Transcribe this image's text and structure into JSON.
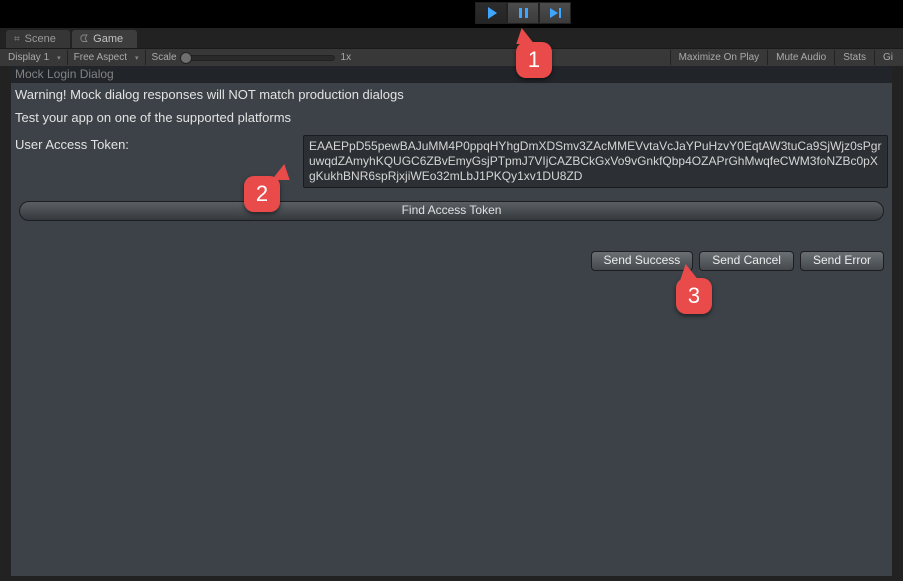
{
  "transport": {
    "play_icon": "play-icon",
    "pause_icon": "pause-icon",
    "step_icon": "step-icon"
  },
  "tabs": {
    "scene": "Scene",
    "game": "Game"
  },
  "options": {
    "display": "Display 1",
    "aspect": "Free Aspect",
    "scale_label": "Scale",
    "scale_value": "1x",
    "maximize": "Maximize On Play",
    "mute": "Mute Audio",
    "stats": "Stats",
    "giz": "Gi"
  },
  "panel": {
    "title": "Mock Login Dialog",
    "warning": "Warning! Mock dialog responses will NOT match production dialogs",
    "platform_msg": "Test your app on one of the supported platforms",
    "token_label": "User Access Token:",
    "token_value": "EAAEPpD55pewBAJuMM4P0ppqHYhgDmXDSmv3ZAcMMEVvtaVcJaYPuHzvY0EqtAW3tuCa9SjWjz0sPgruwqdZAmyhKQUGC6ZBvEmyGsjPTpmJ7VIjCAZBCkGxVo9vGnkfQbp4OZAPrGhMwqfeCWM3foNZBc0pXgKukhBNR6spRjxjiWEo32mLbJ1PKQy1xv1DU8ZD",
    "find_btn": "Find Access Token",
    "send_success": "Send Success",
    "send_cancel": "Send Cancel",
    "send_error": "Send Error"
  },
  "callouts": {
    "c1": "1",
    "c2": "2",
    "c3": "3"
  }
}
